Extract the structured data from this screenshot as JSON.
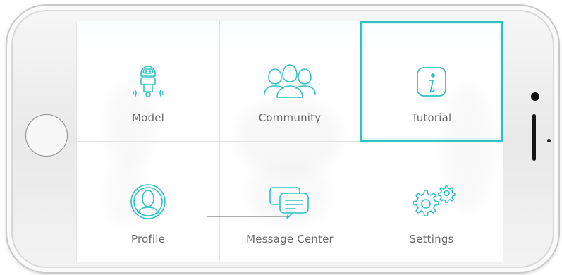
{
  "accent_color": "#2fc2c4",
  "menu": {
    "tiles": [
      {
        "label": "Model",
        "icon": "robot-icon"
      },
      {
        "label": "Community",
        "icon": "group-icon"
      },
      {
        "label": "Tutorial",
        "icon": "info-icon"
      },
      {
        "label": "Profile",
        "icon": "user-avatar-icon"
      },
      {
        "label": "Message Center",
        "icon": "chat-bubbles-icon"
      },
      {
        "label": "Settings",
        "icon": "gears-icon"
      }
    ],
    "selected": "Tutorial"
  }
}
